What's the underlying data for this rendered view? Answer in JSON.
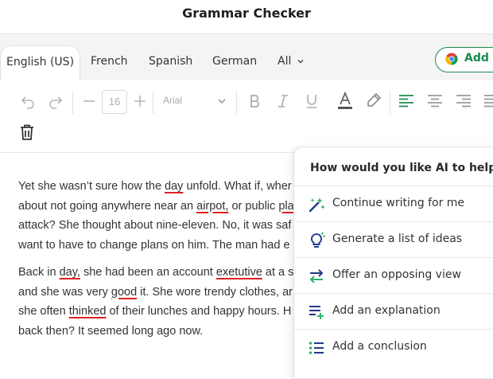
{
  "app": {
    "title": "Grammar Checker"
  },
  "tabs": [
    {
      "label": "English (US)",
      "active": true
    },
    {
      "label": "French"
    },
    {
      "label": "Spanish"
    },
    {
      "label": "German"
    },
    {
      "label": "All"
    }
  ],
  "chrome_button": {
    "label": "Add t"
  },
  "toolbar": {
    "font_size": "16",
    "font_family": "Arial",
    "accent_color": "#1a8a4f"
  },
  "editor": {
    "paragraphs": [
      [
        [
          {
            "t": "Yet she wasn’t sure how the "
          },
          {
            "t": "day",
            "err": true
          },
          {
            "t": " unfold. What if, wher"
          }
        ],
        [
          {
            "t": "about not going anywhere near an "
          },
          {
            "t": "airpot,",
            "err": true
          },
          {
            "t": " or public "
          },
          {
            "t": "pla",
            "err": true
          }
        ],
        [
          {
            "t": "attack? She thought about nine-eleven. No, it was saf"
          }
        ],
        [
          {
            "t": "want to have to change plans on him. The man had e"
          }
        ]
      ],
      [
        [
          {
            "t": "Back in "
          },
          {
            "t": "day,",
            "err": true
          },
          {
            "t": " she had been an account "
          },
          {
            "t": "exetutive",
            "err": true
          },
          {
            "t": " at a s"
          }
        ],
        [
          {
            "t": "and she was very "
          },
          {
            "t": "good",
            "err": true
          },
          {
            "t": " it. She wore trendy clothes, ar"
          }
        ],
        [
          {
            "t": "she often "
          },
          {
            "t": "thinked",
            "err": true
          },
          {
            "t": " of their lunches and happy hours. H"
          }
        ],
        [
          {
            "t": "back then? It seemed long ago now."
          }
        ]
      ]
    ]
  },
  "ai_panel": {
    "heading": "How would you like AI to help?",
    "items": [
      {
        "label": "Continue writing for me",
        "icon": "magic-wand-icon"
      },
      {
        "label": "Generate a list of ideas",
        "icon": "lightbulb-icon"
      },
      {
        "label": "Offer an opposing view",
        "icon": "swap-arrows-icon"
      },
      {
        "label": "Add an explanation",
        "icon": "list-add-icon"
      },
      {
        "label": "Add a conclusion",
        "icon": "bullet-list-icon"
      }
    ]
  }
}
